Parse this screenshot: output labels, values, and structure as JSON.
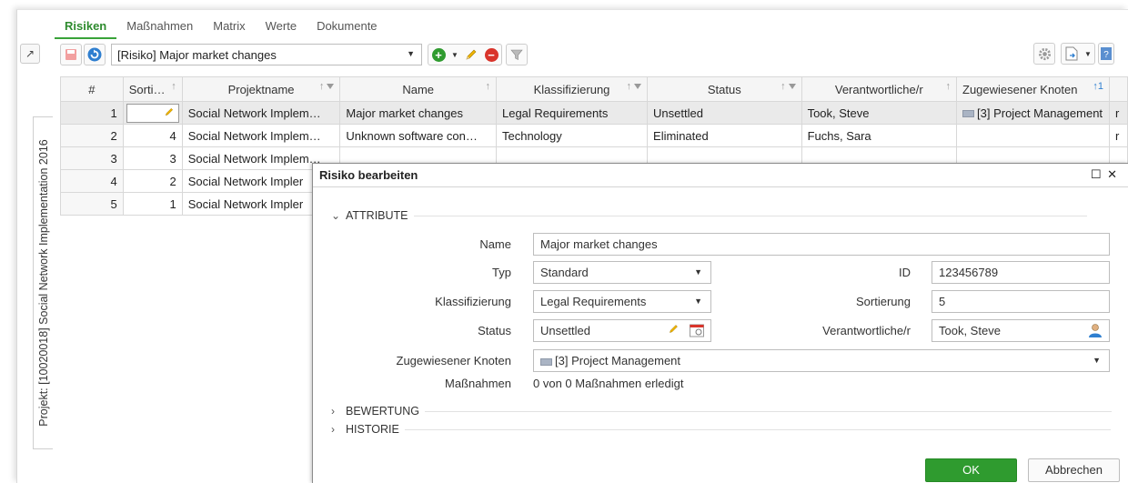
{
  "tabs": [
    "Risiken",
    "Maßnahmen",
    "Matrix",
    "Werte",
    "Dokumente"
  ],
  "side_tab": "Projekt: [10020018] Social Network Implementation 2016",
  "toolbar": {
    "selected_risk": "[Risiko] Major market changes"
  },
  "grid": {
    "columns": [
      "#",
      "Sorti…",
      "Projektname",
      "Name",
      "Klassifizierung",
      "Status",
      "Verantwortliche/r",
      "Zugewiesener Knoten",
      "1"
    ],
    "rows": [
      {
        "num": "1",
        "sort": "",
        "project": "Social Network Implem…",
        "name": "Major market changes",
        "class": "Legal Requirements",
        "status": "Unsettled",
        "owner": "Took, Steve",
        "node": "[3] Project Management",
        "extra": "r"
      },
      {
        "num": "2",
        "sort": "4",
        "project": "Social Network Implem…",
        "name": "Unknown software con…",
        "class": "Technology",
        "status": "Eliminated",
        "owner": "Fuchs, Sara",
        "node": "",
        "extra": "r"
      },
      {
        "num": "3",
        "sort": "3",
        "project": "Social Network Implem…",
        "name": "",
        "class": "",
        "status": "",
        "owner": "",
        "node": "",
        "extra": ""
      },
      {
        "num": "4",
        "sort": "2",
        "project": "Social Network Impler",
        "name": "",
        "class": "",
        "status": "",
        "owner": "",
        "node": "",
        "extra": ""
      },
      {
        "num": "5",
        "sort": "1",
        "project": "Social Network Impler",
        "name": "",
        "class": "",
        "status": "",
        "owner": "",
        "node": "",
        "extra": ""
      }
    ]
  },
  "dialog": {
    "title": "Risiko bearbeiten",
    "section_attr": "ATTRIBUTE",
    "section_eval": "BEWERTUNG",
    "section_hist": "HISTORIE",
    "labels": {
      "name": "Name",
      "typ": "Typ",
      "klass": "Klassifizierung",
      "status": "Status",
      "knoten": "Zugewiesener Knoten",
      "massnahmen": "Maßnahmen",
      "id": "ID",
      "sortierung": "Sortierung",
      "verantw": "Verantwortliche/r"
    },
    "values": {
      "name": "Major market changes",
      "typ": "Standard",
      "klass": "Legal Requirements",
      "status": "Unsettled",
      "knoten": "[3] Project Management",
      "massnahmen": "0 von 0 Maßnahmen erledigt",
      "id": "123456789",
      "sortierung": "5",
      "verantw": "Took, Steve"
    },
    "ok": "OK",
    "cancel": "Abbrechen"
  },
  "colors": {
    "accent_green": "#2f9b2f",
    "delete_red": "#d9342b",
    "info_blue": "#2f7fd0"
  }
}
